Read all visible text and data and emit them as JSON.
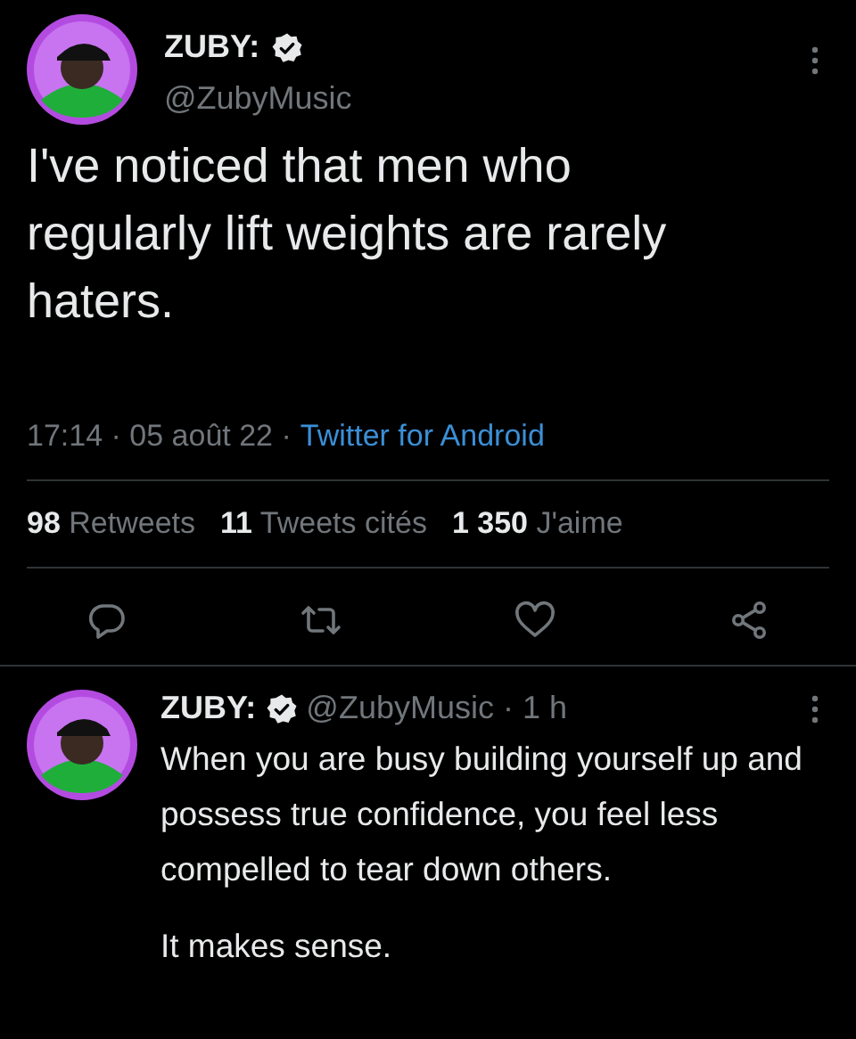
{
  "tweet": {
    "name": "ZUBY:",
    "verified": true,
    "handle": "@ZubyMusic",
    "text": "I've noticed that men who regularly lift weights are rarely haters.",
    "meta": {
      "time": "17:14 · 05 août 22 ·",
      "source": "Twitter for Android"
    },
    "stats": [
      {
        "count": "98",
        "label": "Retweets"
      },
      {
        "count": "11",
        "label": "Tweets cités"
      },
      {
        "count": "1 350",
        "label": "J'aime"
      }
    ],
    "actions": [
      {
        "kind": "reply"
      },
      {
        "kind": "retweet"
      },
      {
        "kind": "like"
      },
      {
        "kind": "share"
      }
    ]
  },
  "reply": {
    "name": "ZUBY:",
    "verified": true,
    "handle_time": "@ZubyMusic · 1 h",
    "paragraphs": [
      "When you are busy building yourself up and possess true confidence, you feel less compelled to tear down others.",
      "It makes sense."
    ]
  }
}
